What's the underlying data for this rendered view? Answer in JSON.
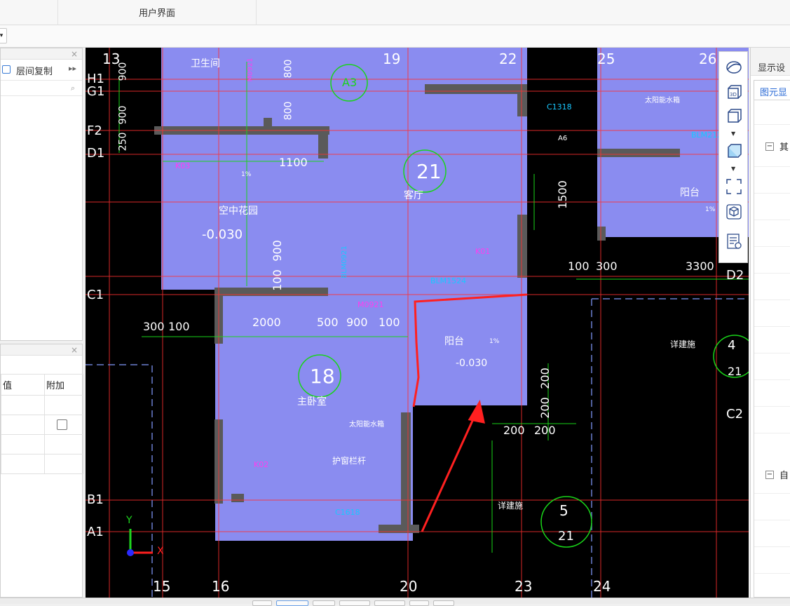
{
  "header": {
    "tab_label": "用户界面"
  },
  "left_panel": {
    "tool_label": "层间复制",
    "more_glyph": "▸▸",
    "search_icon": "🔍",
    "close_glyph": "×"
  },
  "prop_panel": {
    "col_value": "值",
    "col_extra": "附加",
    "close_glyph": "×",
    "extra_checked": false
  },
  "right_panel": {
    "title": "显示设",
    "tab": "图元显",
    "tree_group_1": "其",
    "tree_group_2": "自",
    "tree_toggle": "−"
  },
  "cad": {
    "axis_labels_top": [
      "13",
      "19",
      "22",
      "25",
      "26"
    ],
    "axis_labels_bottom": [
      "15",
      "16",
      "20",
      "23",
      "24"
    ],
    "axis_labels_left": [
      "H1",
      "G1",
      "F2",
      "D1",
      "C1",
      "B1",
      "A1"
    ],
    "axis_labels_right": [
      "D2",
      "C2"
    ],
    "room_numbers": [
      "21",
      "18"
    ],
    "room_names": [
      "客厅",
      "主卧室",
      "空中花园",
      "卫生间",
      "阳台",
      "阳台"
    ],
    "elevations": [
      "-0.030",
      "-0.030"
    ],
    "dims": [
      "1100",
      "1500",
      "900",
      "100",
      "2000",
      "500",
      "900",
      "100",
      "300",
      "100",
      "100",
      "300",
      "3300",
      "200",
      "200",
      "200",
      "200",
      "900",
      "800",
      "800",
      "900",
      "250"
    ],
    "tags": [
      "M0921",
      "BLM1524",
      "BLM0921",
      "M0921",
      "C1318",
      "C1618",
      "K01",
      "K02",
      "K03",
      "BLM2124",
      "A3",
      "A6"
    ],
    "notes": [
      "太阳能水箱",
      "太阳能水箱",
      "护窗栏杆",
      "详建施",
      "详建施",
      "1%",
      "1%",
      "1%"
    ],
    "detail_markers": [
      {
        "num": "4",
        "sheet": "21"
      },
      {
        "num": "5",
        "sheet": "21"
      }
    ],
    "coord_axes": {
      "y": "Y",
      "x": "X"
    },
    "colors": {
      "room_fill": "#8a8cf0",
      "wall": "#5a5a5a",
      "axis": "#ff3030",
      "dim": "#19d419",
      "tag": "#19c8ff",
      "highlight": "#ff2020"
    }
  },
  "view_tools": [
    "orbit-icon",
    "3d-view-icon",
    "box-view-icon",
    "solid-view-icon",
    "fit-view-icon",
    "cube-icon",
    "display-settings-icon"
  ]
}
